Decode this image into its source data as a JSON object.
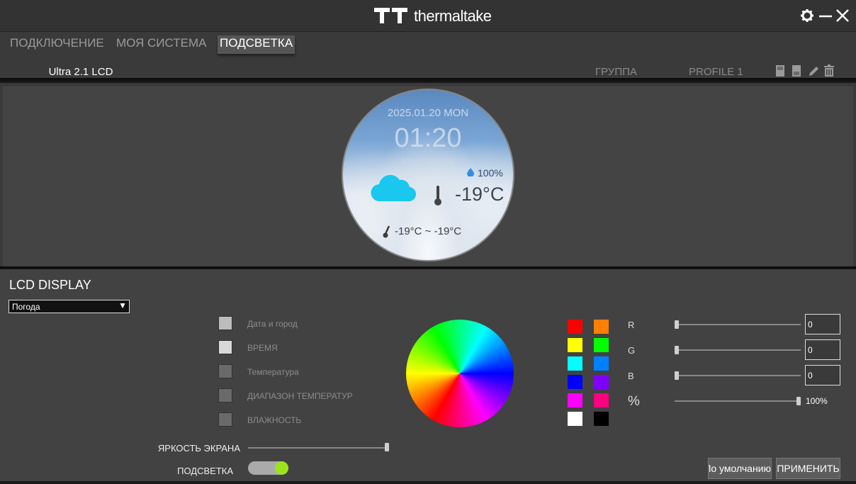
{
  "app": {
    "brand": "thermaltake"
  },
  "nav": {
    "tabs": [
      {
        "label": "ПОДКЛЮЧЕНИЕ",
        "active": false
      },
      {
        "label": "МОЯ СИСТЕМА",
        "active": false
      },
      {
        "label": "ПОДСВЕТКА",
        "active": true
      }
    ],
    "device_tab": "Ultra 2.1 LCD",
    "group_label": "ГРУППА",
    "profile_label": "PROFILE 1",
    "tools": [
      "save-icon",
      "load-icon",
      "edit-icon",
      "delete-icon"
    ]
  },
  "lcd": {
    "date_line": "2025.01.20 MON",
    "time": "01:20",
    "city": "Khabarovsk",
    "humidity": "100%",
    "temperature": "-19°C",
    "range": "-19°C ~ -19°C",
    "weather_icon": "cloud-icon"
  },
  "settings": {
    "title": "LCD DISPLAY",
    "mode_select": "Погода",
    "options": [
      {
        "label": "Дата и город",
        "checked": true
      },
      {
        "label": "ВРЕМЯ",
        "checked": true
      },
      {
        "label": "Температура",
        "checked": false
      },
      {
        "label": "ДИАПАЗОН ТЕМПЕРАТУР",
        "checked": false
      },
      {
        "label": "ВЛАЖНОСТЬ",
        "checked": false
      }
    ],
    "brightness_label": "ЯРКОСТЬ ЭКРАНА",
    "brightness_value": 1.0,
    "backlight_label": "ПОДСВЕТКА",
    "backlight_on": true,
    "swatches": [
      "#ff0000",
      "#ff8000",
      "#ffff00",
      "#00ff00",
      "#00ffff",
      "#0080ff",
      "#0000ff",
      "#8000ff",
      "#ff00ff",
      "#ff0080",
      "#ffffff",
      "#000000"
    ],
    "r_label": "R",
    "g_label": "G",
    "b_label": "B",
    "pct_label": "%",
    "r_value": "0",
    "g_value": "0",
    "b_value": "0",
    "pct_value": "100%",
    "default_button": "По умолчанию",
    "apply_button": "ПРИМЕНИТЬ"
  }
}
